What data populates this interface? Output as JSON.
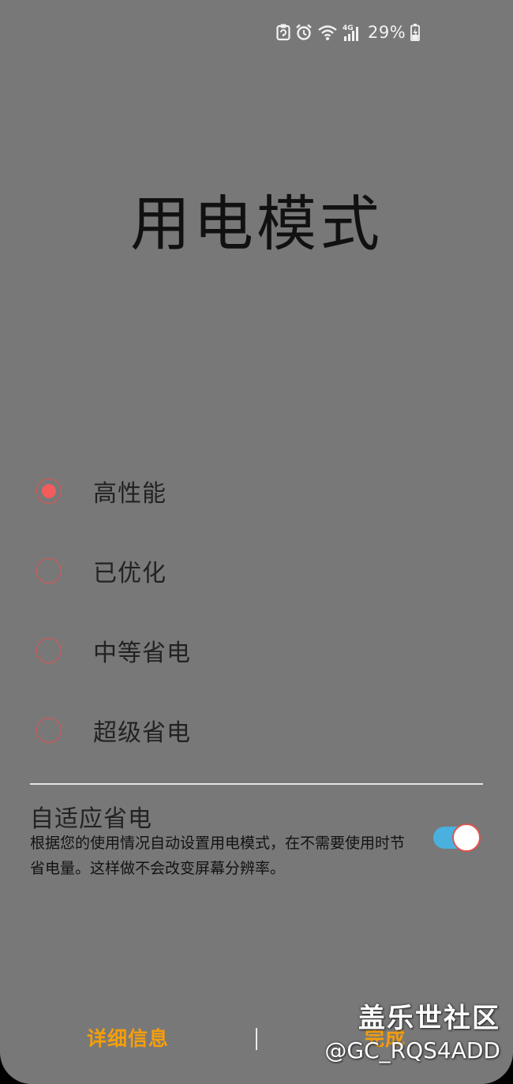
{
  "status_bar": {
    "battery_percent": "29%",
    "icons": [
      "clipboard-icon",
      "alarm-icon",
      "wifi-icon",
      "4g-signal-icon",
      "battery-charging-icon"
    ]
  },
  "page": {
    "title": "用电模式"
  },
  "modes": {
    "selected_index": 0,
    "items": [
      {
        "label": "高性能"
      },
      {
        "label": "已优化"
      },
      {
        "label": "中等省电"
      },
      {
        "label": "超级省电"
      }
    ]
  },
  "adaptive": {
    "title": "自适应省电",
    "description": "根据您的使用情况自动设置用电模式，在不需要使用时节省电量。这样做不会改变屏幕分辨率。",
    "enabled": true
  },
  "footer": {
    "details_label": "详细信息",
    "done_label": "完成"
  },
  "watermark": {
    "line1": "盖乐世社区",
    "line2": "@GC_RQS4ADD"
  },
  "colors": {
    "background": "#787878",
    "accent_radio": "#e2534f",
    "toggle_track": "#4ab0de",
    "button_text": "#f59e0b"
  }
}
